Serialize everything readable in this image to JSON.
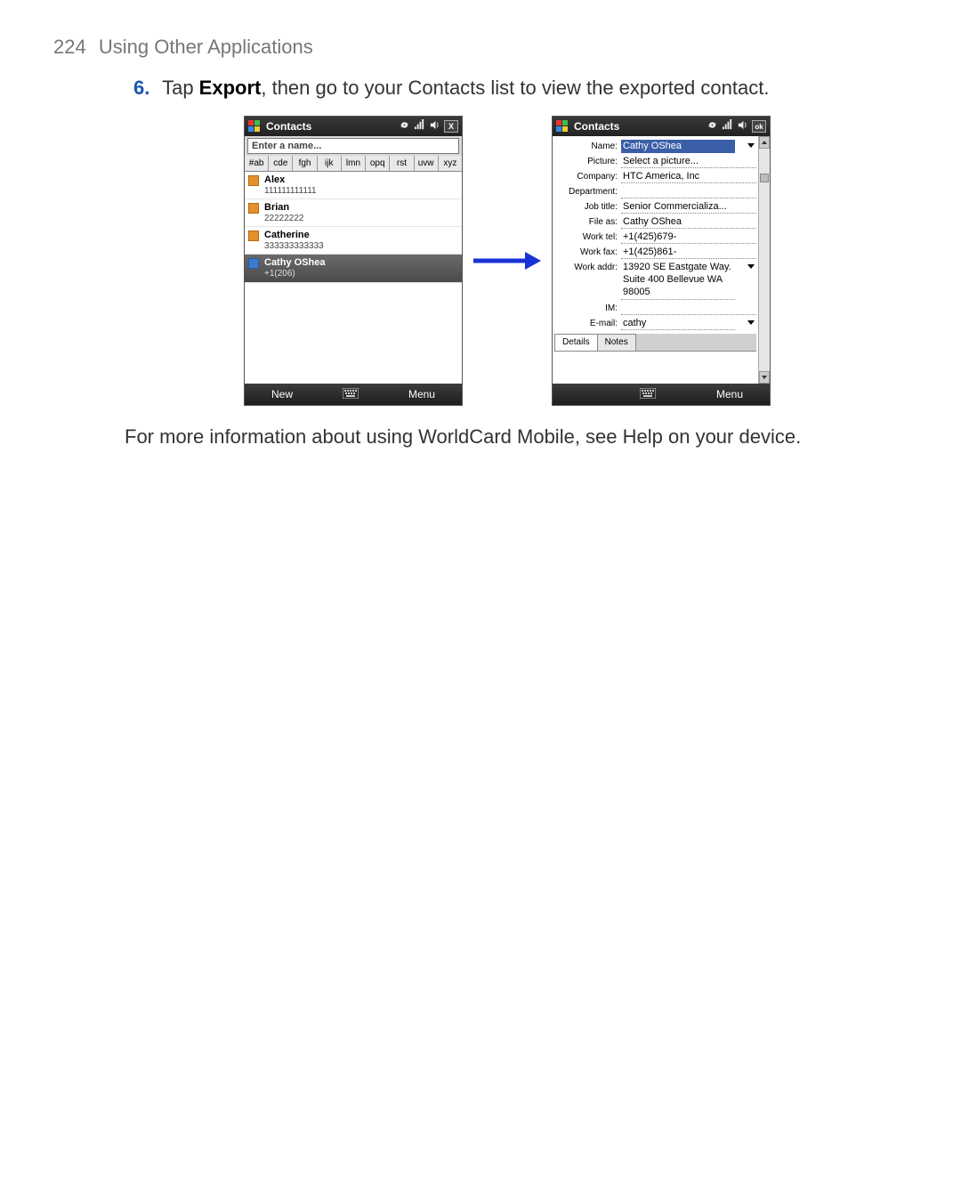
{
  "page": {
    "number": "224",
    "title": "Using Other Applications"
  },
  "step": {
    "num": "6.",
    "pre": "Tap ",
    "bold": "Export",
    "post": ", then go to your Contacts list to view the exported contact."
  },
  "left": {
    "app_title": "Contacts",
    "search_placeholder": "Enter a name...",
    "close_label": "X",
    "alpha_tabs": [
      "#ab",
      "cde",
      "fgh",
      "ijk",
      "lmn",
      "opq",
      "rst",
      "uvw",
      "xyz"
    ],
    "contacts": [
      {
        "name": "Alex",
        "sub": "111111111111"
      },
      {
        "name": "Brian",
        "sub": "22222222"
      },
      {
        "name": "Catherine",
        "sub": "333333333333"
      },
      {
        "name": "Cathy OShea",
        "sub": "+1(206)",
        "selected": true
      }
    ],
    "soft_left": "New",
    "soft_right": "Menu"
  },
  "right": {
    "app_title": "Contacts",
    "ok_label": "ok",
    "fields": [
      {
        "label": "Name:",
        "value": "Cathy OShea",
        "selected": true,
        "dropdown": true
      },
      {
        "label": "Picture:",
        "value": "Select a picture..."
      },
      {
        "label": "Company:",
        "value": "HTC America, Inc"
      },
      {
        "label": "Department:",
        "value": ""
      },
      {
        "label": "Job title:",
        "value": "Senior Commercializa..."
      },
      {
        "label": "File as:",
        "value": "Cathy OShea"
      },
      {
        "label": "Work tel:",
        "value": "+1(425)679-"
      },
      {
        "label": "Work fax:",
        "value": "+1(425)861-"
      },
      {
        "label": "Work addr:",
        "value": "13920 SE Eastgate Way. Suite 400 Bellevue WA 98005",
        "dropdown": true,
        "multiline": true
      },
      {
        "label": "IM:",
        "value": ""
      },
      {
        "label": "E-mail:",
        "value": "cathy",
        "dropdown": true
      }
    ],
    "tabs": {
      "details": "Details",
      "notes": "Notes"
    },
    "soft_right": "Menu"
  },
  "follow": "For more information about using WorldCard Mobile, see Help on your device."
}
